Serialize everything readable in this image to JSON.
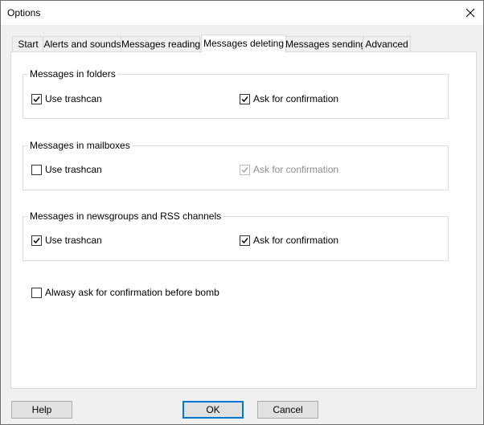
{
  "window": {
    "title": "Options"
  },
  "tabs": [
    {
      "label": "Start",
      "active": false
    },
    {
      "label": "Alerts and sounds",
      "active": false
    },
    {
      "label": "Messages reading",
      "active": false
    },
    {
      "label": "Messages deleting",
      "active": true
    },
    {
      "label": "Messages sending",
      "active": false
    },
    {
      "label": "Advanced",
      "active": false
    }
  ],
  "groups": {
    "folders": {
      "title": "Messages in folders",
      "use_trashcan": {
        "label": "Use trashcan",
        "checked": true,
        "enabled": true
      },
      "ask_confirmation": {
        "label": "Ask for confirmation",
        "checked": true,
        "enabled": true
      }
    },
    "mailboxes": {
      "title": "Messages in mailboxes",
      "use_trashcan": {
        "label": "Use trashcan",
        "checked": false,
        "enabled": true
      },
      "ask_confirmation": {
        "label": "Ask for confirmation",
        "checked": true,
        "enabled": false
      }
    },
    "newsgroups": {
      "title": "Messages in newsgroups and RSS channels",
      "use_trashcan": {
        "label": "Use trashcan",
        "checked": true,
        "enabled": true
      },
      "ask_confirmation": {
        "label": "Ask for confirmation",
        "checked": true,
        "enabled": true
      }
    }
  },
  "always_ask": {
    "label": "Alwasy ask for confirmation before bomb",
    "checked": false,
    "enabled": true
  },
  "buttons": {
    "help": "Help",
    "ok": "OK",
    "cancel": "Cancel"
  },
  "colors": {
    "window_bg": "#f0f0f0",
    "panel_bg": "#ffffff",
    "default_button_border": "#0078d7",
    "disabled_text": "#8d8d8d"
  }
}
